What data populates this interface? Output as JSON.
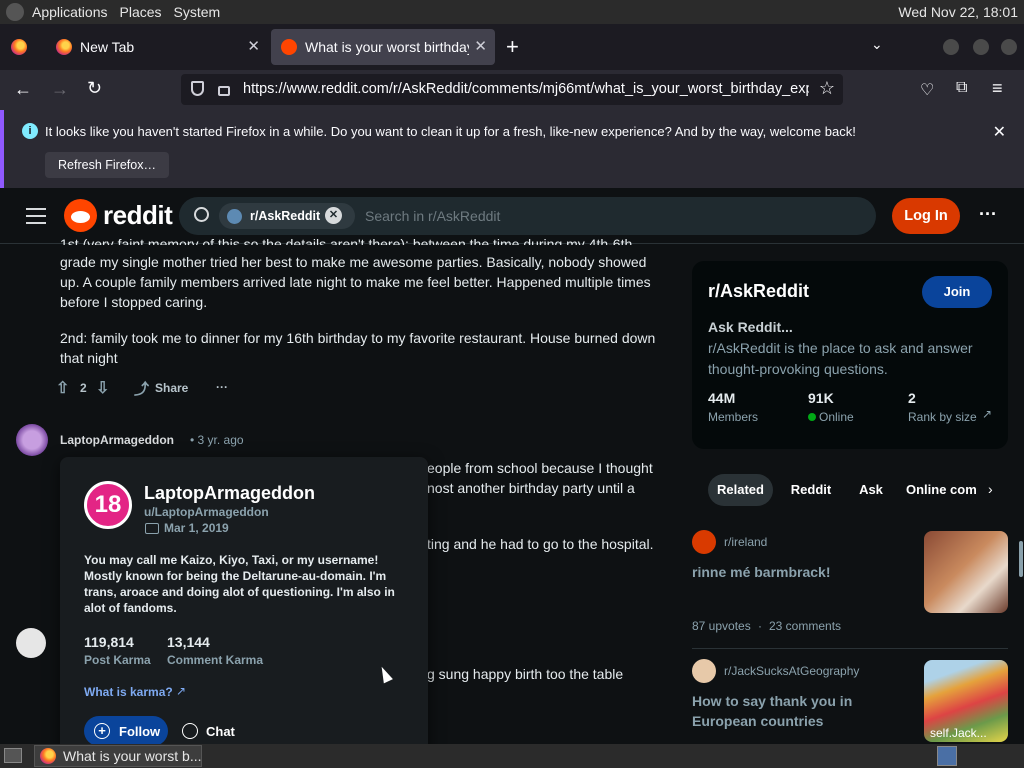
{
  "desktop": {
    "menus": [
      "Applications",
      "Places",
      "System"
    ],
    "clock": "Wed Nov 22, 18:01"
  },
  "browser": {
    "tabs": [
      {
        "label": "New Tab"
      },
      {
        "label": "What is your worst birthday"
      }
    ],
    "url": "https://www.reddit.com/r/AskReddit/comments/mj66mt/what_is_your_worst_birthday_exp",
    "notification": {
      "message": "It looks like you haven't started Firefox in a while. Do you want to clean it up for a fresh, like-new experience? And by the way, welcome back!",
      "button": "Refresh Firefox…"
    }
  },
  "reddit": {
    "logo_text": "reddit",
    "search_chip": "r/AskReddit",
    "search_placeholder": "Search in r/AskReddit",
    "login": "Log In"
  },
  "comment": {
    "partial_line": "1st (very faint memory of this so the details aren't there): between the time during my 4th-6th",
    "para1": "grade my single mother tried her best to make me awesome parties. Basically, nobody showed up. A couple family members arrived late night to make me feel better. Happened multiple times before I stopped caring.",
    "para2": "2nd: family took me to dinner for my 16th birthday to my favorite restaurant. House burned down that night",
    "votes": "2",
    "share": "Share",
    "more": "···"
  },
  "comment2": {
    "author": "LaptopArmageddon",
    "time": "• 3 yr. ago",
    "line1": "eople from school because I thought",
    "line2": "nost another birthday party until a",
    "line3": "ting and he had to go to the hospital.",
    "line4": "g sung happy birth too the table"
  },
  "hovercard": {
    "badge": "18",
    "name": "LaptopArmageddon",
    "handle": "u/LaptopArmageddon",
    "cakeday": "Mar 1, 2019",
    "bio": "You may call me Kaizo, Kiyo, Taxi, or my username! Mostly known for being the Deltarune-au-domain. I'm trans, aroace and doing alot of questioning. I'm also in alot of fandoms.",
    "post_karma": "119,814",
    "post_karma_label": "Post Karma",
    "comment_karma": "13,144",
    "comment_karma_label": "Comment Karma",
    "what_is_karma": "What is karma?",
    "follow": "Follow",
    "chat": "Chat"
  },
  "sidebar": {
    "sub": "r/AskReddit",
    "join": "Join",
    "title": "Ask Reddit...",
    "desc": "r/AskReddit is the place to ask and answer thought-provoking questions.",
    "stats": [
      {
        "value": "44M",
        "label": "Members"
      },
      {
        "value": "91K",
        "label": "Online"
      },
      {
        "value": "2",
        "label": "Rank by size"
      }
    ],
    "pills": [
      "Related",
      "Reddit",
      "Ask",
      "Online com"
    ],
    "posts": [
      {
        "sub": "r/ireland",
        "title": "rinne mé barmbrack!",
        "upvotes": "87 upvotes",
        "comments": "23 comments"
      },
      {
        "sub": "r/JackSucksAtGeography",
        "title": "How to say thank you in European countries",
        "thumb_caption": "self.Jack..."
      }
    ]
  },
  "taskbar": {
    "task": "What is your worst b..."
  }
}
